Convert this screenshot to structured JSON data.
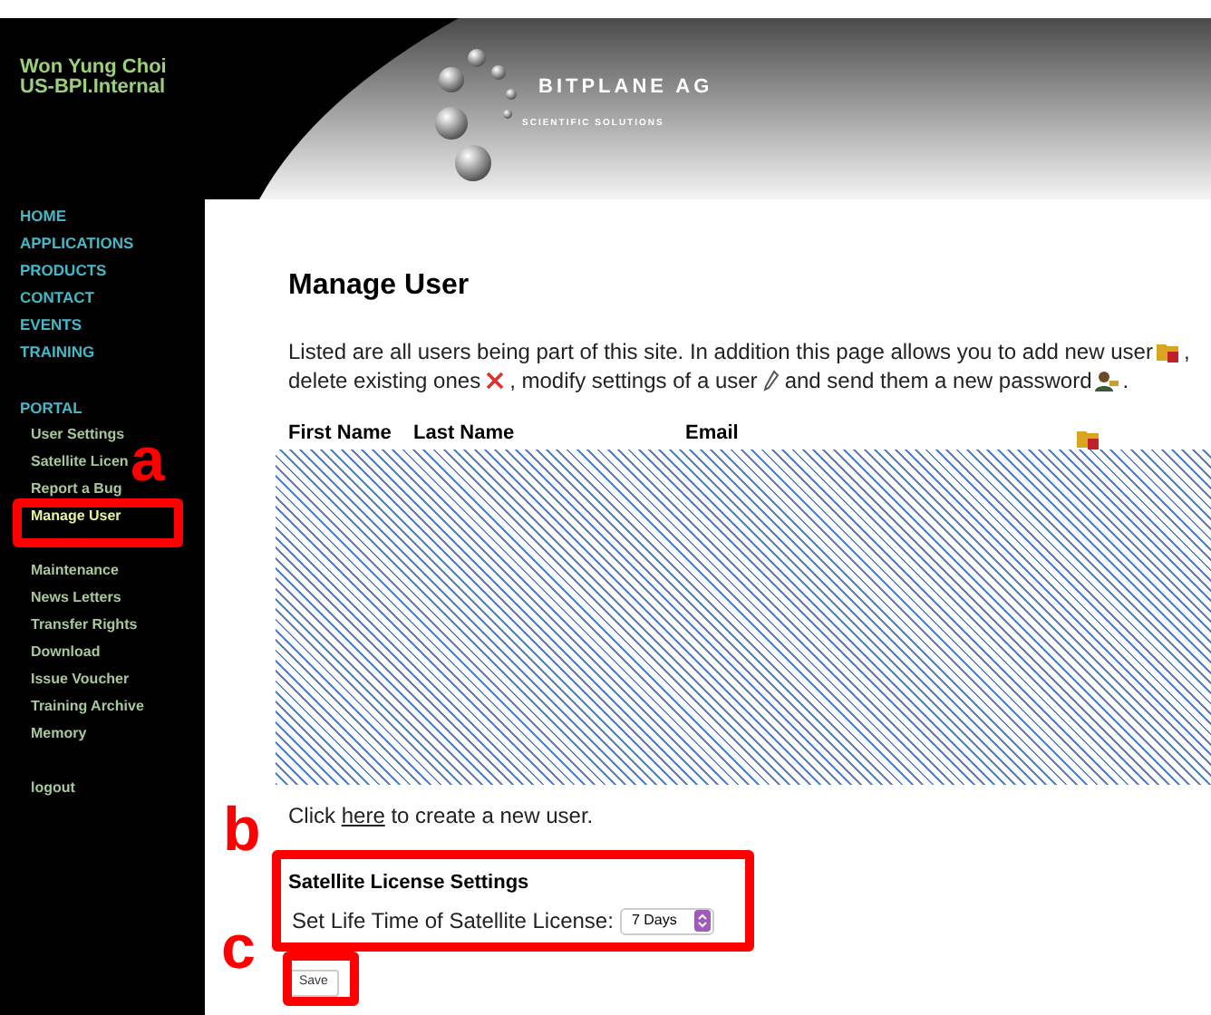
{
  "user": {
    "name": "Won Yung Choi",
    "group": "US-BPI.Internal"
  },
  "logo": {
    "title": "BITPLANE AG",
    "subtitle": "SCIENTIFIC SOLUTIONS"
  },
  "nav": [
    {
      "label": "HOME"
    },
    {
      "label": "APPLICATIONS"
    },
    {
      "label": "PRODUCTS"
    },
    {
      "label": "CONTACT"
    },
    {
      "label": "EVENTS"
    },
    {
      "label": "TRAINING"
    }
  ],
  "portal": {
    "title": "PORTAL",
    "groups": [
      [
        {
          "label": "User Settings",
          "selected": false
        },
        {
          "label": "Satellite Licen",
          "selected": false
        },
        {
          "label": "Report a Bug",
          "selected": false
        },
        {
          "label": "Manage User",
          "selected": true
        }
      ],
      [
        {
          "label": "Maintenance",
          "selected": false
        },
        {
          "label": "News Letters",
          "selected": false
        },
        {
          "label": "Transfer Rights",
          "selected": false
        },
        {
          "label": "Download",
          "selected": false
        },
        {
          "label": "Issue Voucher",
          "selected": false
        },
        {
          "label": "Training Archive",
          "selected": false
        },
        {
          "label": "Memory",
          "selected": false
        }
      ]
    ],
    "logout": "logout"
  },
  "page_title": "Manage User",
  "intro": [
    [
      {
        "kind": "text",
        "text": "Listed are all users being part of this site. In addition this page allows you to add new user"
      },
      {
        "kind": "add"
      },
      {
        "kind": "text",
        "text": ","
      }
    ],
    [
      {
        "kind": "text",
        "text": "delete existing ones"
      },
      {
        "kind": "delete"
      },
      {
        "kind": "text",
        "text": ", modify settings of a user"
      },
      {
        "kind": "edit"
      },
      {
        "kind": "text",
        "text": "and send them a new password"
      },
      {
        "kind": "password"
      },
      {
        "kind": "text",
        "text": "."
      }
    ]
  ],
  "table": {
    "columns": [
      "First Name",
      "Last Name",
      "Email"
    ]
  },
  "create": {
    "before": "Click ",
    "link": "here",
    "after": " to create a new user."
  },
  "satellite": {
    "title": "Satellite License Settings",
    "label": "Set Life Time of Satellite License:",
    "value": "7 Days"
  },
  "save": "Save",
  "annotations": [
    {
      "label": "a"
    },
    {
      "label": "b"
    },
    {
      "label": "c"
    }
  ]
}
